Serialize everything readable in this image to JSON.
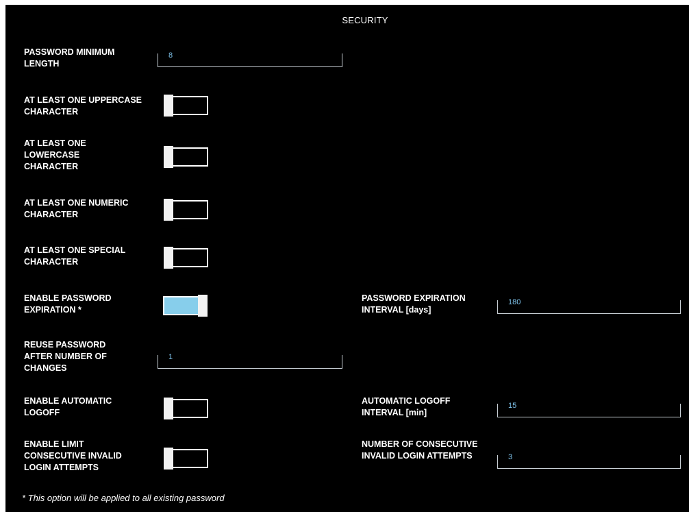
{
  "title": "SECURITY",
  "settings": {
    "min_length": {
      "label": "PASSWORD MINIMUM LENGTH",
      "value": "8"
    },
    "uppercase": {
      "label": "AT LEAST ONE UPPERCASE CHARACTER",
      "enabled": false
    },
    "lowercase": {
      "label": "AT LEAST ONE LOWERCASE CHARACTER",
      "enabled": false
    },
    "numeric": {
      "label": "AT LEAST ONE NUMERIC CHARACTER",
      "enabled": false
    },
    "special": {
      "label": "AT LEAST ONE SPECIAL CHARACTER",
      "enabled": false
    },
    "expiration": {
      "label": "ENABLE PASSWORD EXPIRATION *",
      "enabled": true
    },
    "expiration_interval": {
      "label": "PASSWORD EXPIRATION INTERVAL [days]",
      "value": "180"
    },
    "reuse": {
      "label": "REUSE PASSWORD AFTER NUMBER OF CHANGES",
      "value": "1"
    },
    "auto_logoff": {
      "label": "ENABLE AUTOMATIC LOGOFF",
      "enabled": false
    },
    "logoff_interval": {
      "label": "AUTOMATIC LOGOFF INTERVAL [min]",
      "value": "15"
    },
    "limit_invalid": {
      "label": "ENABLE LIMIT CONSECUTIVE INVALID LOGIN ATTEMPTS",
      "enabled": false
    },
    "invalid_attempts": {
      "label": "NUMBER OF CONSECUTIVE INVALID LOGIN ATTEMPTS",
      "value": "3"
    }
  },
  "footnote": "* This option will be applied to all existing password",
  "colors": {
    "background": "#000000",
    "accent": "#87ceeb",
    "value_text": "#7ec2ea"
  }
}
